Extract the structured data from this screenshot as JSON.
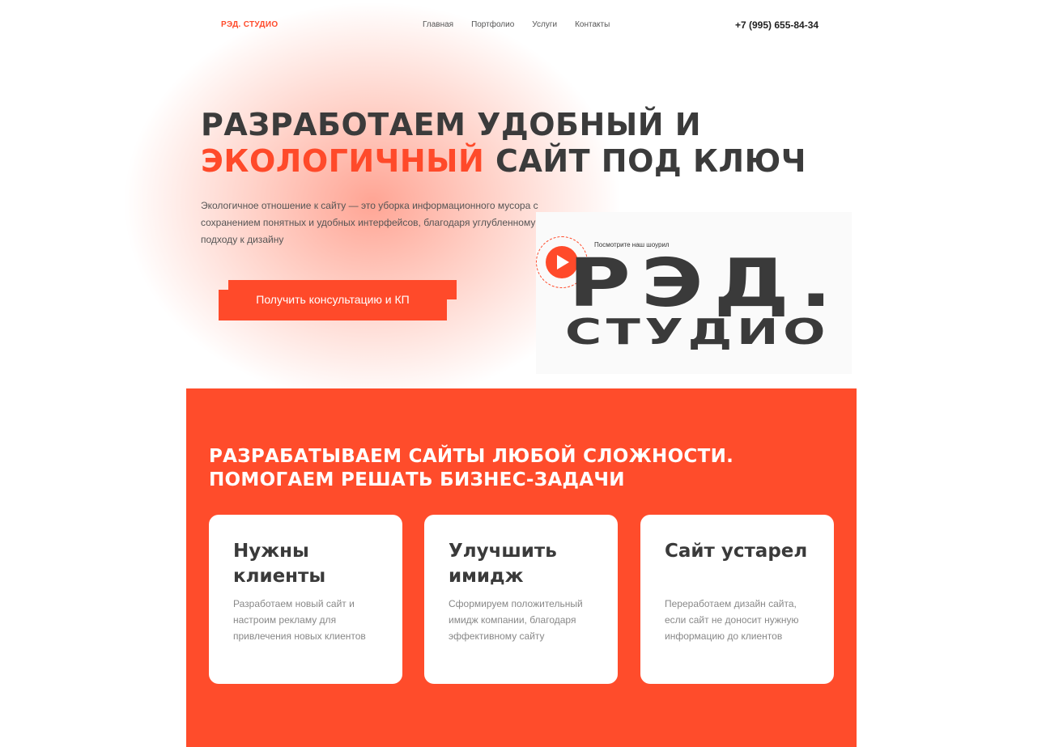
{
  "header": {
    "logo": "РЭД. СТУДИО",
    "nav": [
      "Главная",
      "Портфолио",
      "Услуги",
      "Контакты"
    ],
    "phone": "+7 (995) 655-84-34"
  },
  "hero": {
    "title_line1": "РАЗРАБОТАЕМ УДОБНЫЙ И",
    "title_accent": "ЭКОЛОГИЧНЫЙ",
    "title_line2_rest": " САЙТ ПОД КЛЮЧ",
    "description": "Экологичное отношение к сайту — это уборка информационного мусора с сохранением понятных и удобных интерфейсов, благодаря углубленному подходу к дизайну",
    "cta_label": "Получить консультацию и КП",
    "showreel_label": "Посмотрите наш шоурил",
    "big_logo_line1": "РЭД.",
    "big_logo_line2": "СТУДИО"
  },
  "services": {
    "title_line1": "РАЗРАБАТЫВАЕМ САЙТЫ ЛЮБОЙ СЛОЖНОСТИ.",
    "title_line2": "ПОМОГАЕМ РЕШАТЬ БИЗНЕС-ЗАДАЧИ",
    "cards": [
      {
        "title": "Нужны клиенты",
        "text": "Разработаем новый сайт и настроим рекламу для привлечения новых клиентов"
      },
      {
        "title": "Улучшить имидж",
        "text": "Сформируем положительный имидж компании, благодаря эффективному сайту"
      },
      {
        "title": "Сайт устарел",
        "text": "Переработаем дизайн сайта, если сайт не доносит нужную информацию до клиентов"
      }
    ]
  },
  "colors": {
    "accent": "#ff4a2a",
    "dark": "#3a3a3a"
  }
}
